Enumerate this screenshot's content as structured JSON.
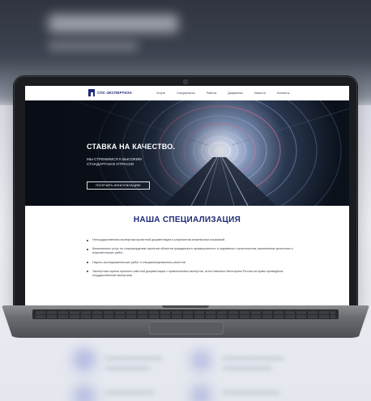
{
  "site": {
    "logo_text": "СПС-ЭКСПЕРТИЗА",
    "menu": [
      "Услуги",
      "Специалисты",
      "Работы",
      "Документы",
      "Новости",
      "Контакты"
    ]
  },
  "hero": {
    "title": "СТАВКА НА КАЧЕСТВО.",
    "subtitle": "МЫ СТРЕМИМСЯ К ВЫСОКИМ СТАНДАРТАМ В ОТРАСЛИ",
    "button_label": "ПОЛУЧИТЬ КОНСУЛЬТАЦИЮ"
  },
  "specialization": {
    "title": "НАША СПЕЦИАЛИЗАЦИЯ",
    "items": [
      "Негосударственная экспертиза проектной документации и результатов инженерных изысканий",
      "Комплексных услуг по сопровождению проектов объектов гражданского промышленного и подземного строительства, выполнения проектных и изыскательских работ",
      "Научно-исследовательских работ и специализированных расчетов",
      "Экспертная оценка проектно-сметной документации с привлечением экспертов, аттестованных Минстроем России на право проведения государственной экспертизы"
    ]
  },
  "colors": {
    "brand": "#1f2a78",
    "hero_dark": "#0d141f",
    "laptop_body": "#1b1c1f"
  },
  "icons": [
    "logo-mark-icon",
    "laptop-camera-icon"
  ]
}
